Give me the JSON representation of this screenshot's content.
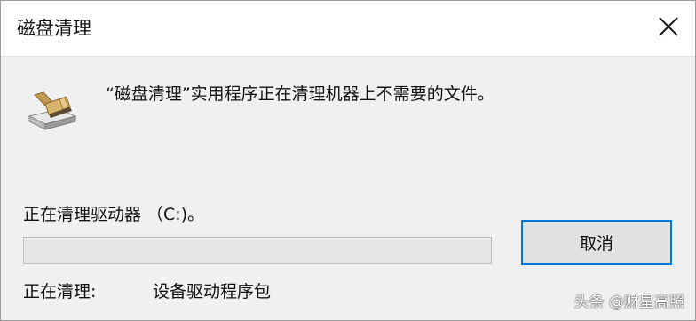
{
  "window": {
    "title": "磁盘清理",
    "close_icon": "close-icon"
  },
  "app_icon": "disk-cleanup-icon",
  "message": "“磁盘清理”实用程序正在清理机器上不需要的文件。",
  "drive_status": "正在清理驱动器 （C:)。",
  "progress": {
    "fraction": 0.0
  },
  "cancel_button": {
    "label": "取消"
  },
  "cleaning": {
    "label": "正在清理:",
    "item": "设备驱动程序包"
  },
  "watermark": "头条 @财星高照",
  "colors": {
    "accent": "#0078d7",
    "progress_fill": "#06b025"
  }
}
